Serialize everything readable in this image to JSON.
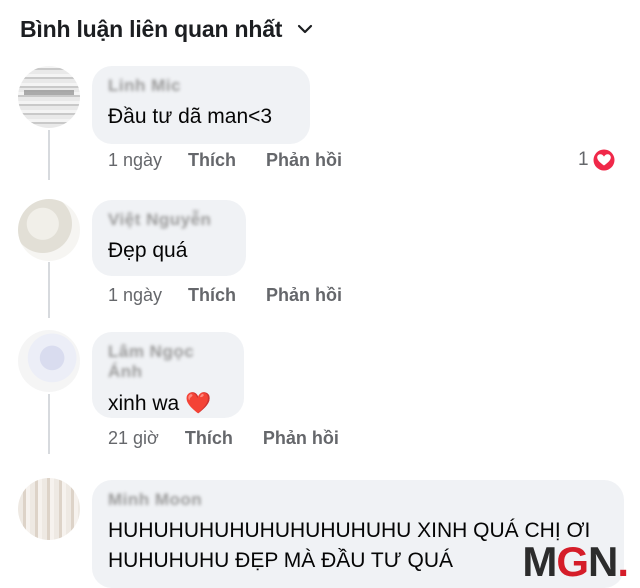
{
  "header": {
    "title": "Bình luận liên quan nhất"
  },
  "comments": [
    {
      "author": "Linh Mic",
      "text": "Đầu tư dã man<3",
      "time": "1 ngày",
      "like_label": "Thích",
      "reply_label": "Phản hồi",
      "reaction_count": "1"
    },
    {
      "author": "Việt Nguyễn",
      "text": "Đẹp quá",
      "time": "1 ngày",
      "like_label": "Thích",
      "reply_label": "Phản hồi"
    },
    {
      "author": "Lâm Ngọc Ánh",
      "text": "xinh wa",
      "emoji": "❤️",
      "time": "21 giờ",
      "like_label": "Thích",
      "reply_label": "Phản hồi"
    },
    {
      "author": "Minh Moon",
      "text_line1": "HUHUHUHUHUHUHUHUHUHU XINH QUÁ CHỊ ƠI",
      "text_line2": "HUHUHUHU ĐẸP MÀ ĐẦU TƯ QUÁ"
    }
  ],
  "watermark": {
    "m": "M",
    "g": "G",
    "n": "N",
    "dot": "."
  },
  "colors": {
    "bubble": "#f0f2f5",
    "meta": "#65676b",
    "heart": "#f02849",
    "brand_red": "#d51d29"
  }
}
